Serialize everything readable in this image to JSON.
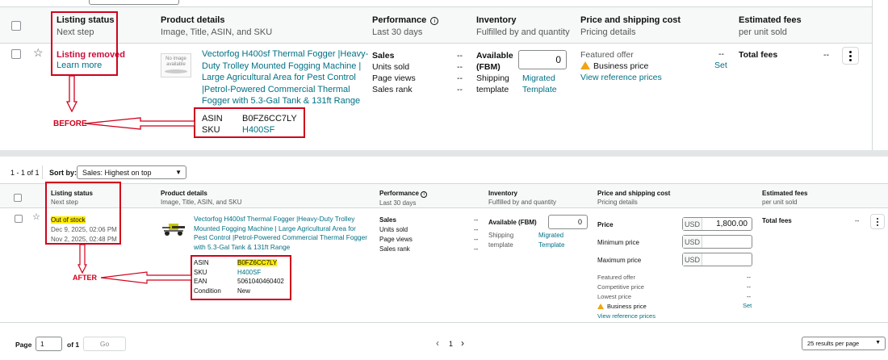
{
  "before": {
    "columns": {
      "listing_status": {
        "title": "Listing status",
        "sub": "Next step"
      },
      "product_details": {
        "title": "Product details",
        "sub": "Image, Title, ASIN, and SKU"
      },
      "performance": {
        "title": "Performance",
        "sub": "Last 30 days"
      },
      "inventory": {
        "title": "Inventory",
        "sub": "Fulfilled by and quantity"
      },
      "price_shipping": {
        "title": "Price and shipping cost",
        "sub": "Pricing details"
      },
      "estimated_fees": {
        "title": "Estimated fees",
        "sub": "per unit sold"
      }
    },
    "row": {
      "status": "Listing removed",
      "learn_more": "Learn more",
      "no_image": "No image available",
      "title_lines": [
        "Vectorfog H400sf Thermal Fogger |Heavy-",
        "Duty Trolley Mounted Fogging Machine |",
        "Large Agricultural Area for Pest Control",
        "|Petrol-Powered Commercial Thermal",
        "Fogger with 5.3-Gal Tank & 131ft Range"
      ],
      "asin_label": "ASIN",
      "asin": "B0FZ6CC7LY",
      "sku_label": "SKU",
      "sku": "H400SF",
      "perf_labels": [
        "Sales",
        "Units sold",
        "Page views",
        "Sales rank"
      ],
      "perf_values": [
        "--",
        "--",
        "--",
        "--"
      ],
      "available_label_1": "Available",
      "available_label_2": "(FBM)",
      "quantity": "0",
      "shipping_label_1": "Shipping",
      "shipping_label_2": "template",
      "shipping_link_1": "Migrated",
      "shipping_link_2": "Template",
      "featured_offer": "Featured offer",
      "featured_value": "--",
      "business_price": "Business price",
      "business_set": "Set",
      "view_ref": "View reference prices",
      "total_fees": "Total fees",
      "total_fees_value": "--"
    },
    "annotation": "BEFORE"
  },
  "after": {
    "range_label": "1 - 1 of 1",
    "sort_label": "Sort by:",
    "sort_value": "Sales: Highest on top",
    "columns": {
      "listing_status": {
        "title": "Listing status",
        "sub": "Next step"
      },
      "product_details": {
        "title": "Product details",
        "sub": "Image, Title, ASIN, and SKU"
      },
      "performance": {
        "title": "Performance",
        "sub": "Last 30 days"
      },
      "inventory": {
        "title": "Inventory",
        "sub": "Fulfilled by and quantity"
      },
      "price_shipping": {
        "title": "Price and shipping cost",
        "sub": "Pricing details"
      },
      "estimated_fees": {
        "title": "Estimated fees",
        "sub": "per unit sold"
      }
    },
    "row": {
      "status": "Out of stock",
      "date1": "Dec 9, 2025, 02:06 PM",
      "date2": "Nov 2, 2025, 02:48 PM",
      "title_lines": [
        "Vectorfog H400sf Thermal Fogger |Heavy-Duty Trolley",
        "Mounted Fogging Machine | Large Agricultural Area for",
        "Pest Control |Petrol-Powered Commercial Thermal Fogger",
        "with 5.3-Gal Tank & 131ft Range"
      ],
      "asin_label": "ASIN",
      "asin": "B0FZ6CC7LY",
      "sku_label": "SKU",
      "sku": "H400SF",
      "ean_label": "EAN",
      "ean": "5061040460402",
      "condition_label": "Condition",
      "condition": "New",
      "perf_labels": [
        "Sales",
        "Units sold",
        "Page views",
        "Sales rank"
      ],
      "perf_values": [
        "--",
        "--",
        "--",
        "--"
      ],
      "available_label": "Available (FBM)",
      "quantity": "0",
      "shipping_label_1": "Shipping",
      "shipping_label_2": "template",
      "shipping_link_1": "Migrated",
      "shipping_link_2": "Template",
      "price_label": "Price",
      "price_currency": "USD",
      "price_value": "1,800.00",
      "min_price_label": "Minimum price",
      "min_currency": "USD",
      "max_price_label": "Maximum price",
      "max_currency": "USD",
      "featured_offer": "Featured offer",
      "competitive_price": "Competitive price",
      "lowest_price": "Lowest price",
      "business_price": "Business price",
      "featured_value": "--",
      "competitive_value": "--",
      "lowest_value": "--",
      "business_set": "Set",
      "view_ref": "View reference prices",
      "total_fees": "Total fees",
      "total_fees_value": "--"
    },
    "annotation": "AFTER"
  },
  "pagination": {
    "page_label": "Page",
    "page_value": "1",
    "of_label": "of 1",
    "go_label": "Go",
    "prev": "‹",
    "current": "1",
    "next": "›",
    "per_page": "25 results per page"
  },
  "colors": {
    "annotation_red": "#d0021b",
    "link": "#007185",
    "status_removed": "#cc0c39",
    "highlight": "#ffeb00"
  }
}
